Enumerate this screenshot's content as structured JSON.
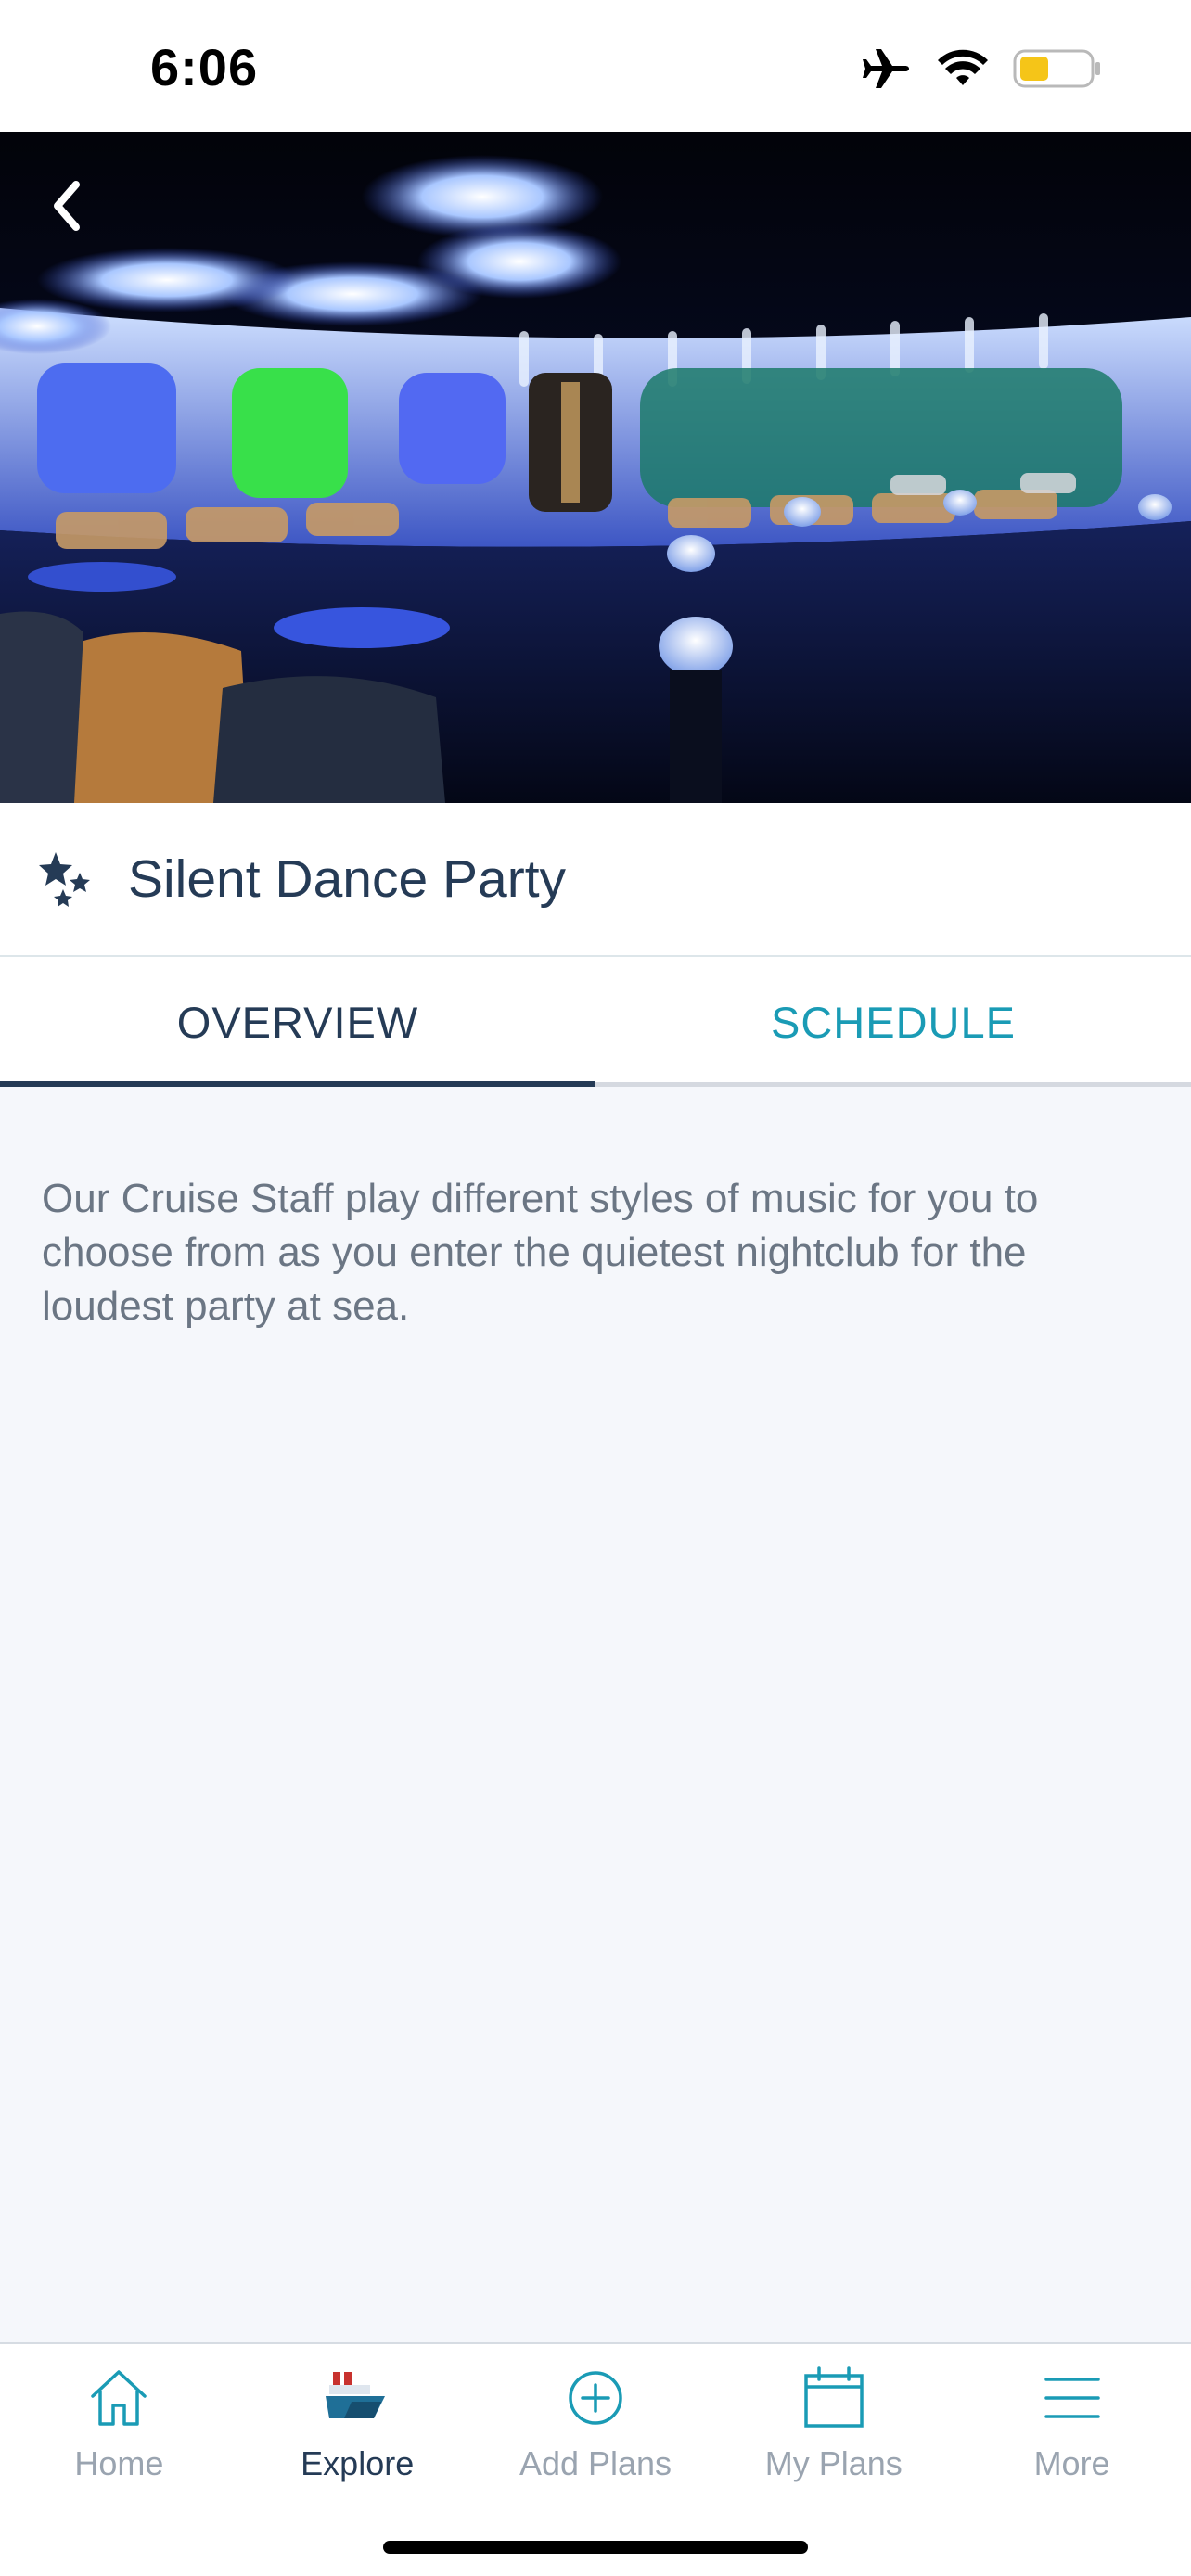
{
  "status_bar": {
    "time": "6:06",
    "icons": [
      "airplane-icon",
      "wifi-icon",
      "battery-icon"
    ],
    "battery_color": "#f5c518"
  },
  "hero": {
    "image": "nightclub-photo",
    "back_icon": "chevron-left-icon"
  },
  "header": {
    "title": "Silent Dance Party",
    "icon": "stars-icon"
  },
  "tabs": [
    {
      "label": "OVERVIEW",
      "active": true
    },
    {
      "label": "SCHEDULE",
      "active": false
    }
  ],
  "overview": {
    "description": "Our Cruise Staff play different styles of music for you to choose from as you enter the quietest nightclub for the loudest party at sea."
  },
  "nav": [
    {
      "label": "Home",
      "icon": "home-icon",
      "active": false
    },
    {
      "label": "Explore",
      "icon": "ship-icon",
      "active": true
    },
    {
      "label": "Add Plans",
      "icon": "plus-circle-icon",
      "active": false
    },
    {
      "label": "My Plans",
      "icon": "calendar-icon",
      "active": false
    },
    {
      "label": "More",
      "icon": "menu-icon",
      "active": false
    }
  ],
  "colors": {
    "navy": "#253b56",
    "teal": "#1a9bb5",
    "muted": "#9aa4b0",
    "background": "#f5f7fb"
  }
}
